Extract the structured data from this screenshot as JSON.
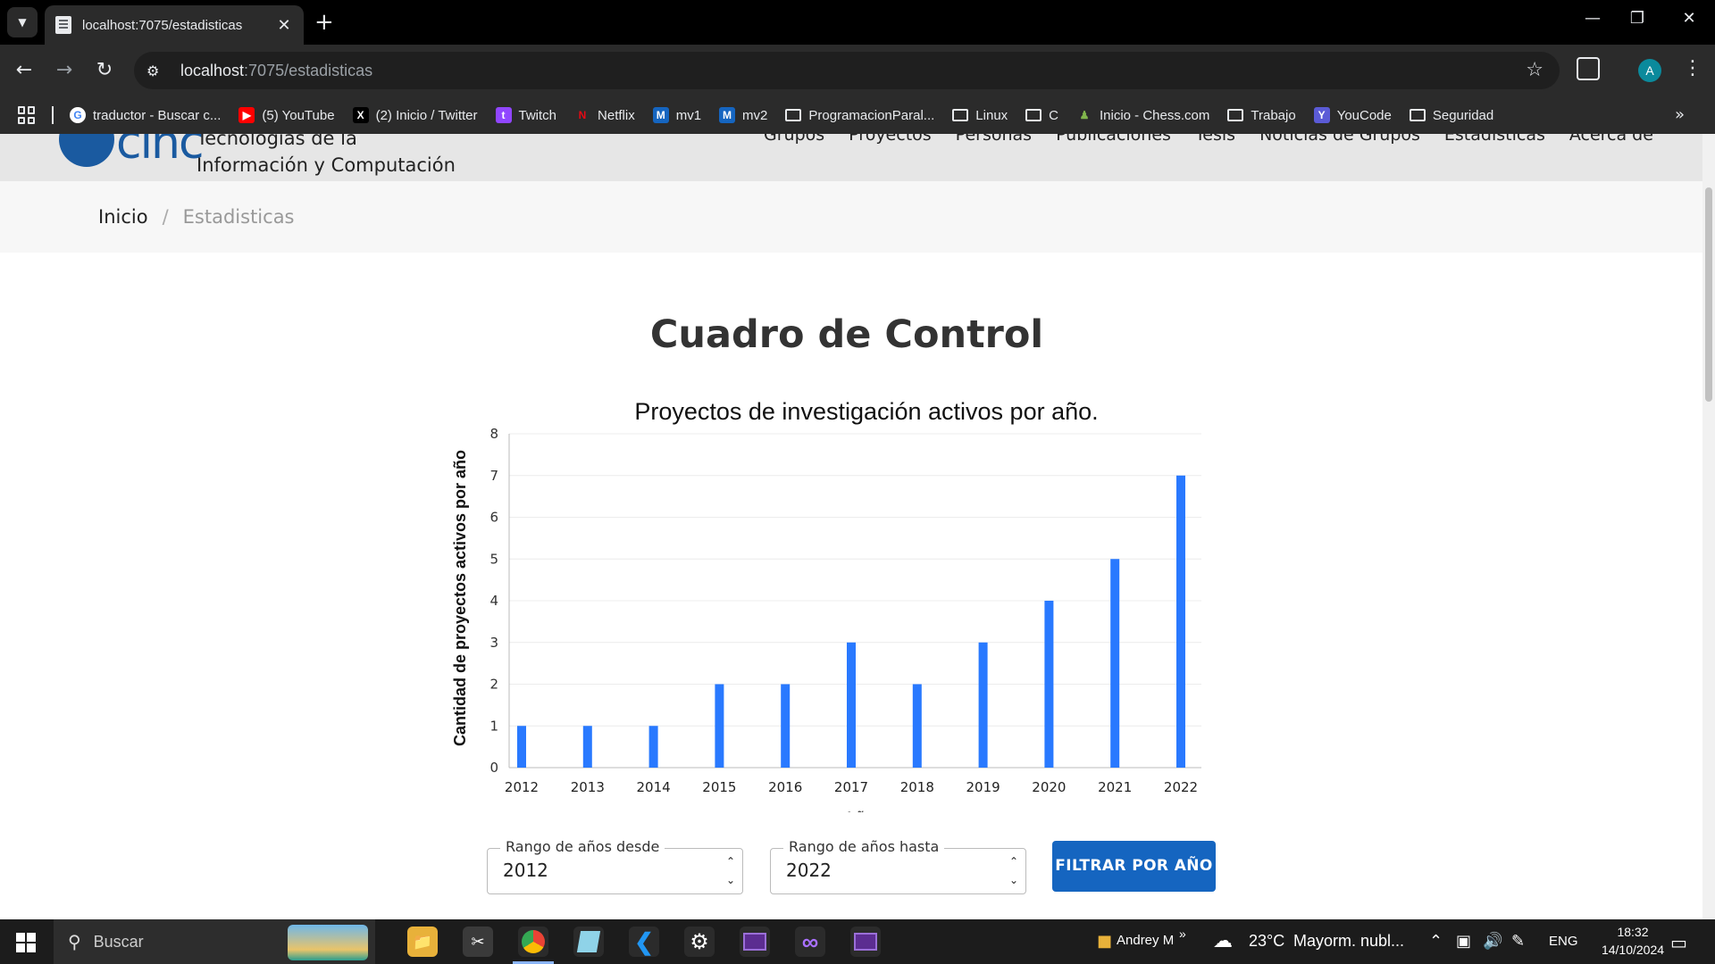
{
  "browser": {
    "tab_title": "localhost:7075/estadisticas",
    "url_host": "localhost",
    "url_path": ":7075/estadisticas",
    "profile_initial": "A",
    "bookmarks": [
      {
        "label": "traductor - Buscar c...",
        "icon": "google-icon"
      },
      {
        "label": "(5) YouTube",
        "icon": "youtube-icon"
      },
      {
        "label": "(2) Inicio / Twitter",
        "icon": "x-icon"
      },
      {
        "label": "Twitch",
        "icon": "twitch-icon"
      },
      {
        "label": "Netflix",
        "icon": "netflix-icon"
      },
      {
        "label": "mv1",
        "icon": "m-icon"
      },
      {
        "label": "mv2",
        "icon": "m-icon"
      },
      {
        "label": "ProgramacionParal...",
        "icon": "folder-icon"
      },
      {
        "label": "Linux",
        "icon": "folder-icon"
      },
      {
        "label": "C",
        "icon": "folder-icon"
      },
      {
        "label": "Inicio - Chess.com",
        "icon": "chess-icon"
      },
      {
        "label": "Trabajo",
        "icon": "folder-icon"
      },
      {
        "label": "YouCode",
        "icon": "youcode-icon"
      },
      {
        "label": "Seguridad",
        "icon": "folder-icon"
      }
    ]
  },
  "site": {
    "logo_text": "cinc",
    "org_name_line1": "Tecnologías de la",
    "org_name_line2": "Información y Computación",
    "nav": [
      "Grupos",
      "Proyectos",
      "Personas",
      "Publicaciones",
      "Tesis",
      "Noticias de Grupos",
      "Estadisticas",
      "Acerca de"
    ]
  },
  "breadcrumb": {
    "home": "Inicio",
    "separator": "/",
    "current": "Estadisticas"
  },
  "page": {
    "title": "Cuadro de Control"
  },
  "chart_data": {
    "type": "bar",
    "title": "Proyectos de investigación activos por año.",
    "xlabel": "Años",
    "ylabel": "Cantidad de proyectos activos por año",
    "categories": [
      "2012",
      "2013",
      "2014",
      "2015",
      "2016",
      "2017",
      "2018",
      "2019",
      "2020",
      "2021",
      "2022"
    ],
    "values": [
      1,
      1,
      1,
      2,
      2,
      3,
      2,
      3,
      4,
      5,
      7
    ],
    "ylim": [
      0,
      8
    ],
    "yticks": [
      "0",
      "1",
      "2",
      "3",
      "4",
      "5",
      "6",
      "7",
      "8"
    ],
    "grid": true,
    "bar_color": "#2979ff"
  },
  "filter": {
    "from_label": "Rango de años desde",
    "from_value": "2012",
    "to_label": "Rango de años hasta",
    "to_value": "2022",
    "button_label": "FILTRAR POR AÑO"
  },
  "taskbar": {
    "search_placeholder": "Buscar",
    "user": "Andrey M",
    "weather_temp": "23°C",
    "weather_desc": "Mayorm. nubl...",
    "lang": "ENG",
    "time": "18:32",
    "date": "14/10/2024"
  }
}
